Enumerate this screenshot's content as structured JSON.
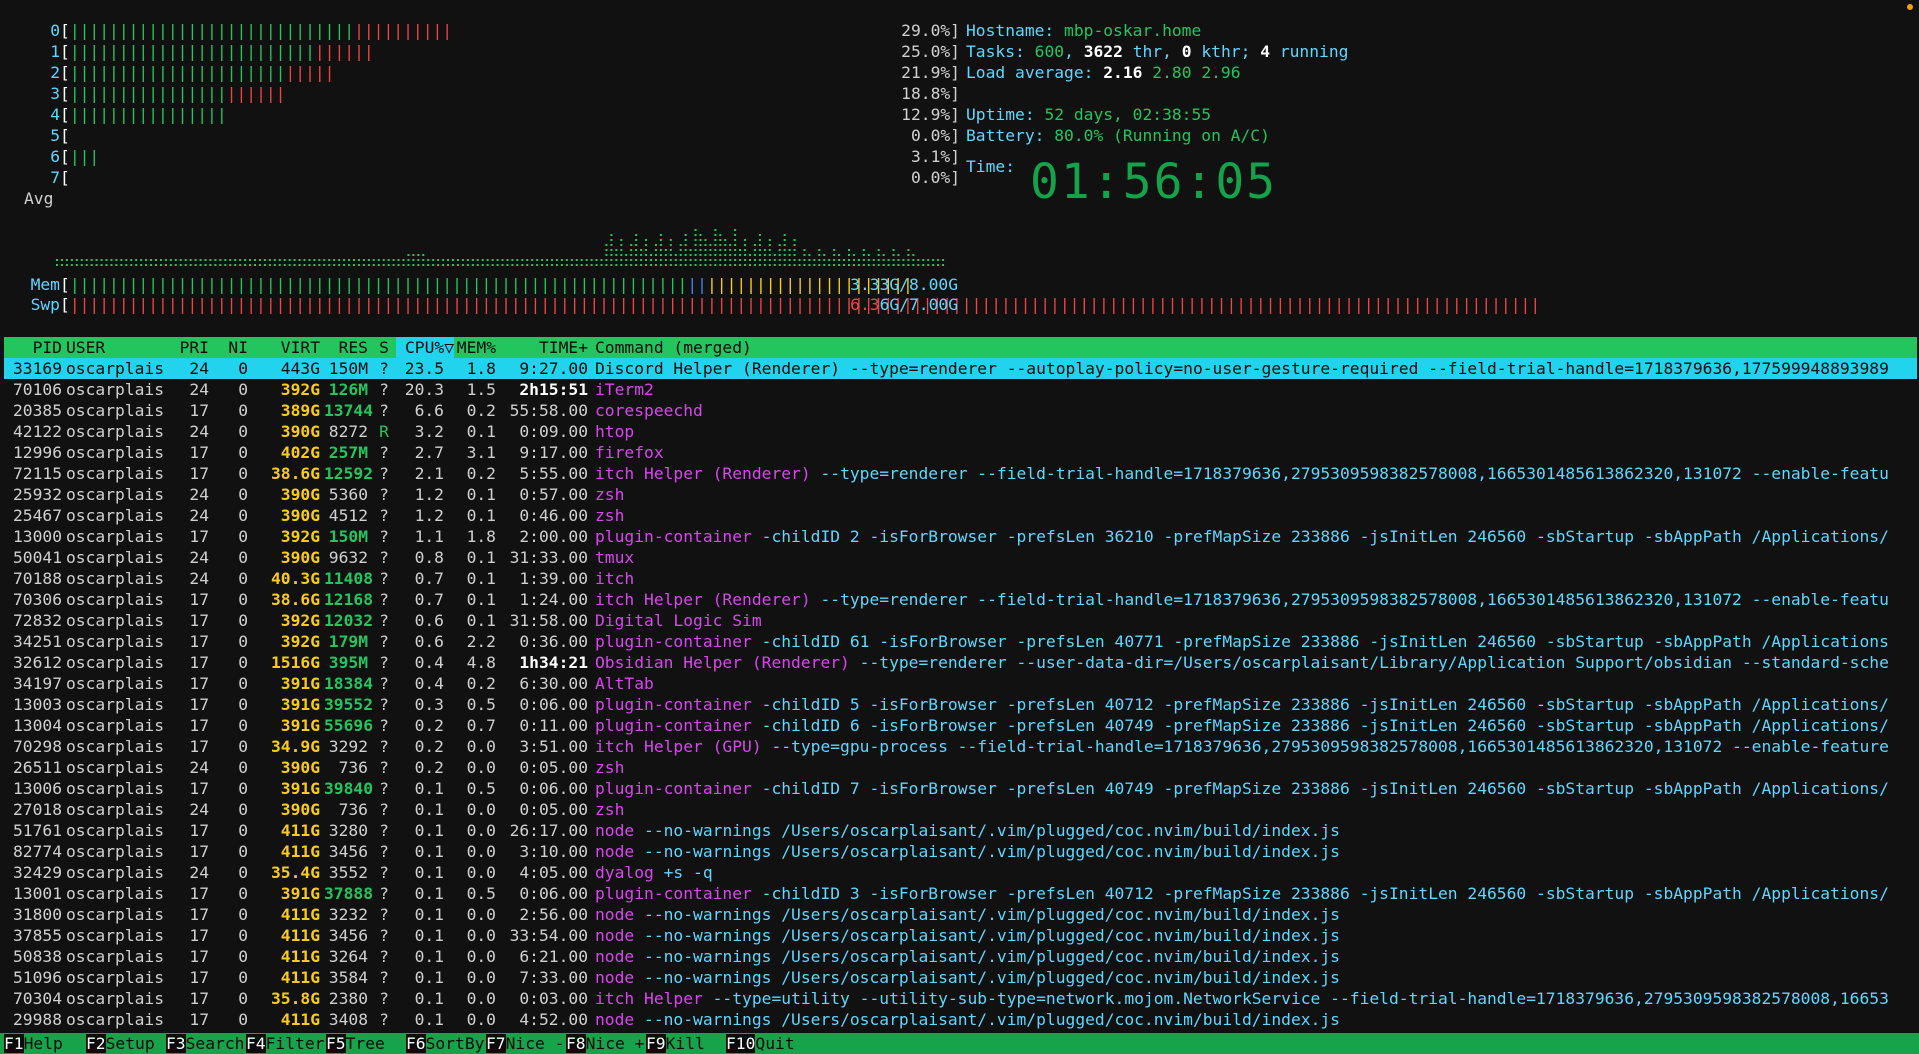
{
  "cpu_meters": [
    {
      "label": "0",
      "green": 29,
      "red": 10,
      "pct": "29.0%]"
    },
    {
      "label": "1",
      "green": 25,
      "red": 6,
      "pct": "25.0%]"
    },
    {
      "label": "2",
      "green": 22,
      "red": 5,
      "pct": "21.9%]"
    },
    {
      "label": "3",
      "green": 16,
      "red": 6,
      "pct": "18.8%]"
    },
    {
      "label": "4",
      "green": 16,
      "red": 0,
      "pct": "12.9%]"
    },
    {
      "label": "5",
      "green": 0,
      "red": 0,
      "pct": "0.0%]"
    },
    {
      "label": "6",
      "green": 3,
      "red": 0,
      "pct": "3.1%]"
    },
    {
      "label": "7",
      "green": 0,
      "red": 0,
      "pct": "0.0%]"
    }
  ],
  "avg_label": "Avg",
  "info": {
    "hostname_key": "Hostname:",
    "hostname_val": "mbp-oskar.home",
    "tasks_key": "Tasks:",
    "tasks_count": "600",
    "tasks_thr": "3622",
    "tasks_thr_label": "thr,",
    "tasks_kthr": "0",
    "tasks_kthr_label": "kthr;",
    "tasks_running": "4",
    "tasks_running_label": "running",
    "load_key": "Load average:",
    "load_1": "2.16",
    "load_5": "2.80",
    "load_15": "2.96",
    "uptime_key": "Uptime:",
    "uptime_val": "52 days, 02:38:55",
    "battery_key": "Battery:",
    "battery_val": "80.0% (Running on A/C)",
    "time_key": "Time:",
    "clock": "01:56:05"
  },
  "mem": {
    "label": "Mem",
    "value": "3.33G/8.00G",
    "fraction": 0.416
  },
  "swp": {
    "label": "Swp",
    "value_red": "6.3",
    "value_rest": "6G/7.00G",
    "fraction": 0.905
  },
  "table": {
    "headers": {
      "pid": "PID",
      "user": "USER",
      "pri": "PRI",
      "ni": "NI",
      "virt": "VIRT",
      "res": "RES",
      "s": "S",
      "cpu": "CPU%▽",
      "mem": "MEM%",
      "time": "TIME+",
      "cmd": "Command (merged)"
    },
    "rows": [
      {
        "pid": "33169",
        "user": "oscarplais",
        "pri": "24",
        "ni": "0",
        "virt": "443G",
        "res": "150M",
        "s": "?",
        "cpu": "23.5",
        "mem": "1.8",
        "time": "9:27.00",
        "cmd": "Discord Helper (Renderer)",
        "args": " --type=renderer --autoplay-policy=no-user-gesture-required --field-trial-handle=1718379636,177599948893989",
        "selected": true
      },
      {
        "pid": "70106",
        "user": "oscarplais",
        "pri": "24",
        "ni": "0",
        "virt": "392G",
        "res": "126M",
        "s": "?",
        "cpu": "20.3",
        "mem": "1.5",
        "time": "2h15:51",
        "cmd": "iTerm2",
        "args": ""
      },
      {
        "pid": "20385",
        "user": "oscarplais",
        "pri": "17",
        "ni": "0",
        "virt": "389G",
        "res": "13744",
        "s": "?",
        "cpu": "6.6",
        "mem": "0.2",
        "time": "55:58.00",
        "cmd": "corespeechd",
        "args": ""
      },
      {
        "pid": "42122",
        "user": "oscarplais",
        "pri": "24",
        "ni": "0",
        "virt": "390G",
        "res": "8272",
        "s": "R",
        "cpu": "3.2",
        "mem": "0.1",
        "time": "0:09.00",
        "cmd": "htop",
        "args": ""
      },
      {
        "pid": "12996",
        "user": "oscarplais",
        "pri": "17",
        "ni": "0",
        "virt": "402G",
        "res": "257M",
        "s": "?",
        "cpu": "2.7",
        "mem": "3.1",
        "time": "9:17.00",
        "cmd": "firefox",
        "args": ""
      },
      {
        "pid": "72115",
        "user": "oscarplais",
        "pri": "17",
        "ni": "0",
        "virt": "38.6G",
        "res": "12592",
        "s": "?",
        "cpu": "2.1",
        "mem": "0.2",
        "time": "5:55.00",
        "cmd": "itch Helper (Renderer)",
        "args": " --type=renderer --field-trial-handle=1718379636,2795309598382578008,1665301485613862320,131072 --enable-featu"
      },
      {
        "pid": "25932",
        "user": "oscarplais",
        "pri": "24",
        "ni": "0",
        "virt": "390G",
        "res": "5360",
        "s": "?",
        "cpu": "1.2",
        "mem": "0.1",
        "time": "0:57.00",
        "cmd": "zsh",
        "args": ""
      },
      {
        "pid": "25467",
        "user": "oscarplais",
        "pri": "24",
        "ni": "0",
        "virt": "390G",
        "res": "4512",
        "s": "?",
        "cpu": "1.2",
        "mem": "0.1",
        "time": "0:46.00",
        "cmd": "zsh",
        "args": ""
      },
      {
        "pid": "13000",
        "user": "oscarplais",
        "pri": "17",
        "ni": "0",
        "virt": "392G",
        "res": "150M",
        "s": "?",
        "cpu": "1.1",
        "mem": "1.8",
        "time": "2:00.00",
        "cmd": "plugin-container",
        "args": " -childID 2 -isForBrowser -prefsLen 36210 -prefMapSize 233886 -jsInitLen 246560 -sbStartup -sbAppPath /Applications/"
      },
      {
        "pid": "50041",
        "user": "oscarplais",
        "pri": "24",
        "ni": "0",
        "virt": "390G",
        "res": "9632",
        "s": "?",
        "cpu": "0.8",
        "mem": "0.1",
        "time": "31:33.00",
        "cmd": "tmux",
        "args": ""
      },
      {
        "pid": "70188",
        "user": "oscarplais",
        "pri": "24",
        "ni": "0",
        "virt": "40.3G",
        "res": "11408",
        "s": "?",
        "cpu": "0.7",
        "mem": "0.1",
        "time": "1:39.00",
        "cmd": "itch",
        "args": ""
      },
      {
        "pid": "70306",
        "user": "oscarplais",
        "pri": "17",
        "ni": "0",
        "virt": "38.6G",
        "res": "12168",
        "s": "?",
        "cpu": "0.7",
        "mem": "0.1",
        "time": "1:24.00",
        "cmd": "itch Helper (Renderer)",
        "args": " --type=renderer --field-trial-handle=1718379636,2795309598382578008,1665301485613862320,131072 --enable-featu"
      },
      {
        "pid": "72832",
        "user": "oscarplais",
        "pri": "17",
        "ni": "0",
        "virt": "392G",
        "res": "12032",
        "s": "?",
        "cpu": "0.6",
        "mem": "0.1",
        "time": "31:58.00",
        "cmd": "Digital Logic Sim",
        "args": ""
      },
      {
        "pid": "34251",
        "user": "oscarplais",
        "pri": "17",
        "ni": "0",
        "virt": "392G",
        "res": "179M",
        "s": "?",
        "cpu": "0.6",
        "mem": "2.2",
        "time": "0:36.00",
        "cmd": "plugin-container",
        "args": " -childID 61 -isForBrowser -prefsLen 40771 -prefMapSize 233886 -jsInitLen 246560 -sbStartup -sbAppPath /Applications"
      },
      {
        "pid": "32612",
        "user": "oscarplais",
        "pri": "17",
        "ni": "0",
        "virt": "1516G",
        "res": "395M",
        "s": "?",
        "cpu": "0.4",
        "mem": "4.8",
        "time": "1h34:21",
        "cmd": "Obsidian Helper (Renderer)",
        "args": " --type=renderer --user-data-dir=/Users/oscarplaisant/Library/Application Support/obsidian --standard-sche"
      },
      {
        "pid": "34197",
        "user": "oscarplais",
        "pri": "17",
        "ni": "0",
        "virt": "391G",
        "res": "18384",
        "s": "?",
        "cpu": "0.4",
        "mem": "0.2",
        "time": "6:30.00",
        "cmd": "AltTab",
        "args": ""
      },
      {
        "pid": "13003",
        "user": "oscarplais",
        "pri": "17",
        "ni": "0",
        "virt": "391G",
        "res": "39552",
        "s": "?",
        "cpu": "0.3",
        "mem": "0.5",
        "time": "0:06.00",
        "cmd": "plugin-container",
        "args": " -childID 5 -isForBrowser -prefsLen 40712 -prefMapSize 233886 -jsInitLen 246560 -sbStartup -sbAppPath /Applications/"
      },
      {
        "pid": "13004",
        "user": "oscarplais",
        "pri": "17",
        "ni": "0",
        "virt": "391G",
        "res": "55696",
        "s": "?",
        "cpu": "0.2",
        "mem": "0.7",
        "time": "0:11.00",
        "cmd": "plugin-container",
        "args": " -childID 6 -isForBrowser -prefsLen 40749 -prefMapSize 233886 -jsInitLen 246560 -sbStartup -sbAppPath /Applications/"
      },
      {
        "pid": "70298",
        "user": "oscarplais",
        "pri": "17",
        "ni": "0",
        "virt": "34.9G",
        "res": "3292",
        "s": "?",
        "cpu": "0.2",
        "mem": "0.0",
        "time": "3:51.00",
        "cmd": "itch Helper (GPU)",
        "args": " --type=gpu-process --field-trial-handle=1718379636,2795309598382578008,1665301485613862320,131072 --enable-feature"
      },
      {
        "pid": "26511",
        "user": "oscarplais",
        "pri": "24",
        "ni": "0",
        "virt": "390G",
        "res": "736",
        "s": "?",
        "cpu": "0.2",
        "mem": "0.0",
        "time": "0:05.00",
        "cmd": "zsh",
        "args": ""
      },
      {
        "pid": "13006",
        "user": "oscarplais",
        "pri": "17",
        "ni": "0",
        "virt": "391G",
        "res": "39840",
        "s": "?",
        "cpu": "0.1",
        "mem": "0.5",
        "time": "0:06.00",
        "cmd": "plugin-container",
        "args": " -childID 7 -isForBrowser -prefsLen 40749 -prefMapSize 233886 -jsInitLen 246560 -sbStartup -sbAppPath /Applications/"
      },
      {
        "pid": "27018",
        "user": "oscarplais",
        "pri": "24",
        "ni": "0",
        "virt": "390G",
        "res": "736",
        "s": "?",
        "cpu": "0.1",
        "mem": "0.0",
        "time": "0:05.00",
        "cmd": "zsh",
        "args": ""
      },
      {
        "pid": "51761",
        "user": "oscarplais",
        "pri": "17",
        "ni": "0",
        "virt": "411G",
        "res": "3280",
        "s": "?",
        "cpu": "0.1",
        "mem": "0.0",
        "time": "26:17.00",
        "cmd": "node",
        "args": " --no-warnings /Users/oscarplaisant/.vim/plugged/coc.nvim/build/index.js"
      },
      {
        "pid": "82774",
        "user": "oscarplais",
        "pri": "17",
        "ni": "0",
        "virt": "411G",
        "res": "3456",
        "s": "?",
        "cpu": "0.1",
        "mem": "0.0",
        "time": "3:10.00",
        "cmd": "node",
        "args": " --no-warnings /Users/oscarplaisant/.vim/plugged/coc.nvim/build/index.js"
      },
      {
        "pid": "32429",
        "user": "oscarplais",
        "pri": "24",
        "ni": "0",
        "virt": "35.4G",
        "res": "3552",
        "s": "?",
        "cpu": "0.1",
        "mem": "0.0",
        "time": "4:05.00",
        "cmd": "dyalog",
        "args": " +s -q"
      },
      {
        "pid": "13001",
        "user": "oscarplais",
        "pri": "17",
        "ni": "0",
        "virt": "391G",
        "res": "37888",
        "s": "?",
        "cpu": "0.1",
        "mem": "0.5",
        "time": "0:06.00",
        "cmd": "plugin-container",
        "args": " -childID 3 -isForBrowser -prefsLen 40712 -prefMapSize 233886 -jsInitLen 246560 -sbStartup -sbAppPath /Applications/"
      },
      {
        "pid": "31800",
        "user": "oscarplais",
        "pri": "17",
        "ni": "0",
        "virt": "411G",
        "res": "3232",
        "s": "?",
        "cpu": "0.1",
        "mem": "0.0",
        "time": "2:56.00",
        "cmd": "node",
        "args": " --no-warnings /Users/oscarplaisant/.vim/plugged/coc.nvim/build/index.js"
      },
      {
        "pid": "37855",
        "user": "oscarplais",
        "pri": "17",
        "ni": "0",
        "virt": "411G",
        "res": "3456",
        "s": "?",
        "cpu": "0.1",
        "mem": "0.0",
        "time": "33:54.00",
        "cmd": "node",
        "args": " --no-warnings /Users/oscarplaisant/.vim/plugged/coc.nvim/build/index.js"
      },
      {
        "pid": "50838",
        "user": "oscarplais",
        "pri": "17",
        "ni": "0",
        "virt": "411G",
        "res": "3264",
        "s": "?",
        "cpu": "0.1",
        "mem": "0.0",
        "time": "6:21.00",
        "cmd": "node",
        "args": " --no-warnings /Users/oscarplaisant/.vim/plugged/coc.nvim/build/index.js"
      },
      {
        "pid": "51096",
        "user": "oscarplais",
        "pri": "17",
        "ni": "0",
        "virt": "411G",
        "res": "3584",
        "s": "?",
        "cpu": "0.1",
        "mem": "0.0",
        "time": "7:33.00",
        "cmd": "node",
        "args": " --no-warnings /Users/oscarplaisant/.vim/plugged/coc.nvim/build/index.js"
      },
      {
        "pid": "70304",
        "user": "oscarplais",
        "pri": "17",
        "ni": "0",
        "virt": "35.8G",
        "res": "2380",
        "s": "?",
        "cpu": "0.1",
        "mem": "0.0",
        "time": "0:03.00",
        "cmd": "itch Helper",
        "args": " --type=utility --utility-sub-type=network.mojom.NetworkService --field-trial-handle=1718379636,2795309598382578008,16653"
      },
      {
        "pid": "29988",
        "user": "oscarplais",
        "pri": "17",
        "ni": "0",
        "virt": "411G",
        "res": "3408",
        "s": "?",
        "cpu": "0.1",
        "mem": "0.0",
        "time": "4:52.00",
        "cmd": "node",
        "args": " --no-warnings /Users/oscarplaisant/.vim/plugged/coc.nvim/build/index.js"
      }
    ]
  },
  "fkeys": [
    {
      "num": "F1",
      "label": "Help"
    },
    {
      "num": "F2",
      "label": "Setup"
    },
    {
      "num": "F3",
      "label": "Search"
    },
    {
      "num": "F4",
      "label": "Filter"
    },
    {
      "num": "F5",
      "label": "Tree"
    },
    {
      "num": "F6",
      "label": "SortBy"
    },
    {
      "num": "F7",
      "label": "Nice -"
    },
    {
      "num": "F8",
      "label": "Nice +"
    },
    {
      "num": "F9",
      "label": "Kill"
    },
    {
      "num": "F10",
      "label": "Quit"
    }
  ]
}
